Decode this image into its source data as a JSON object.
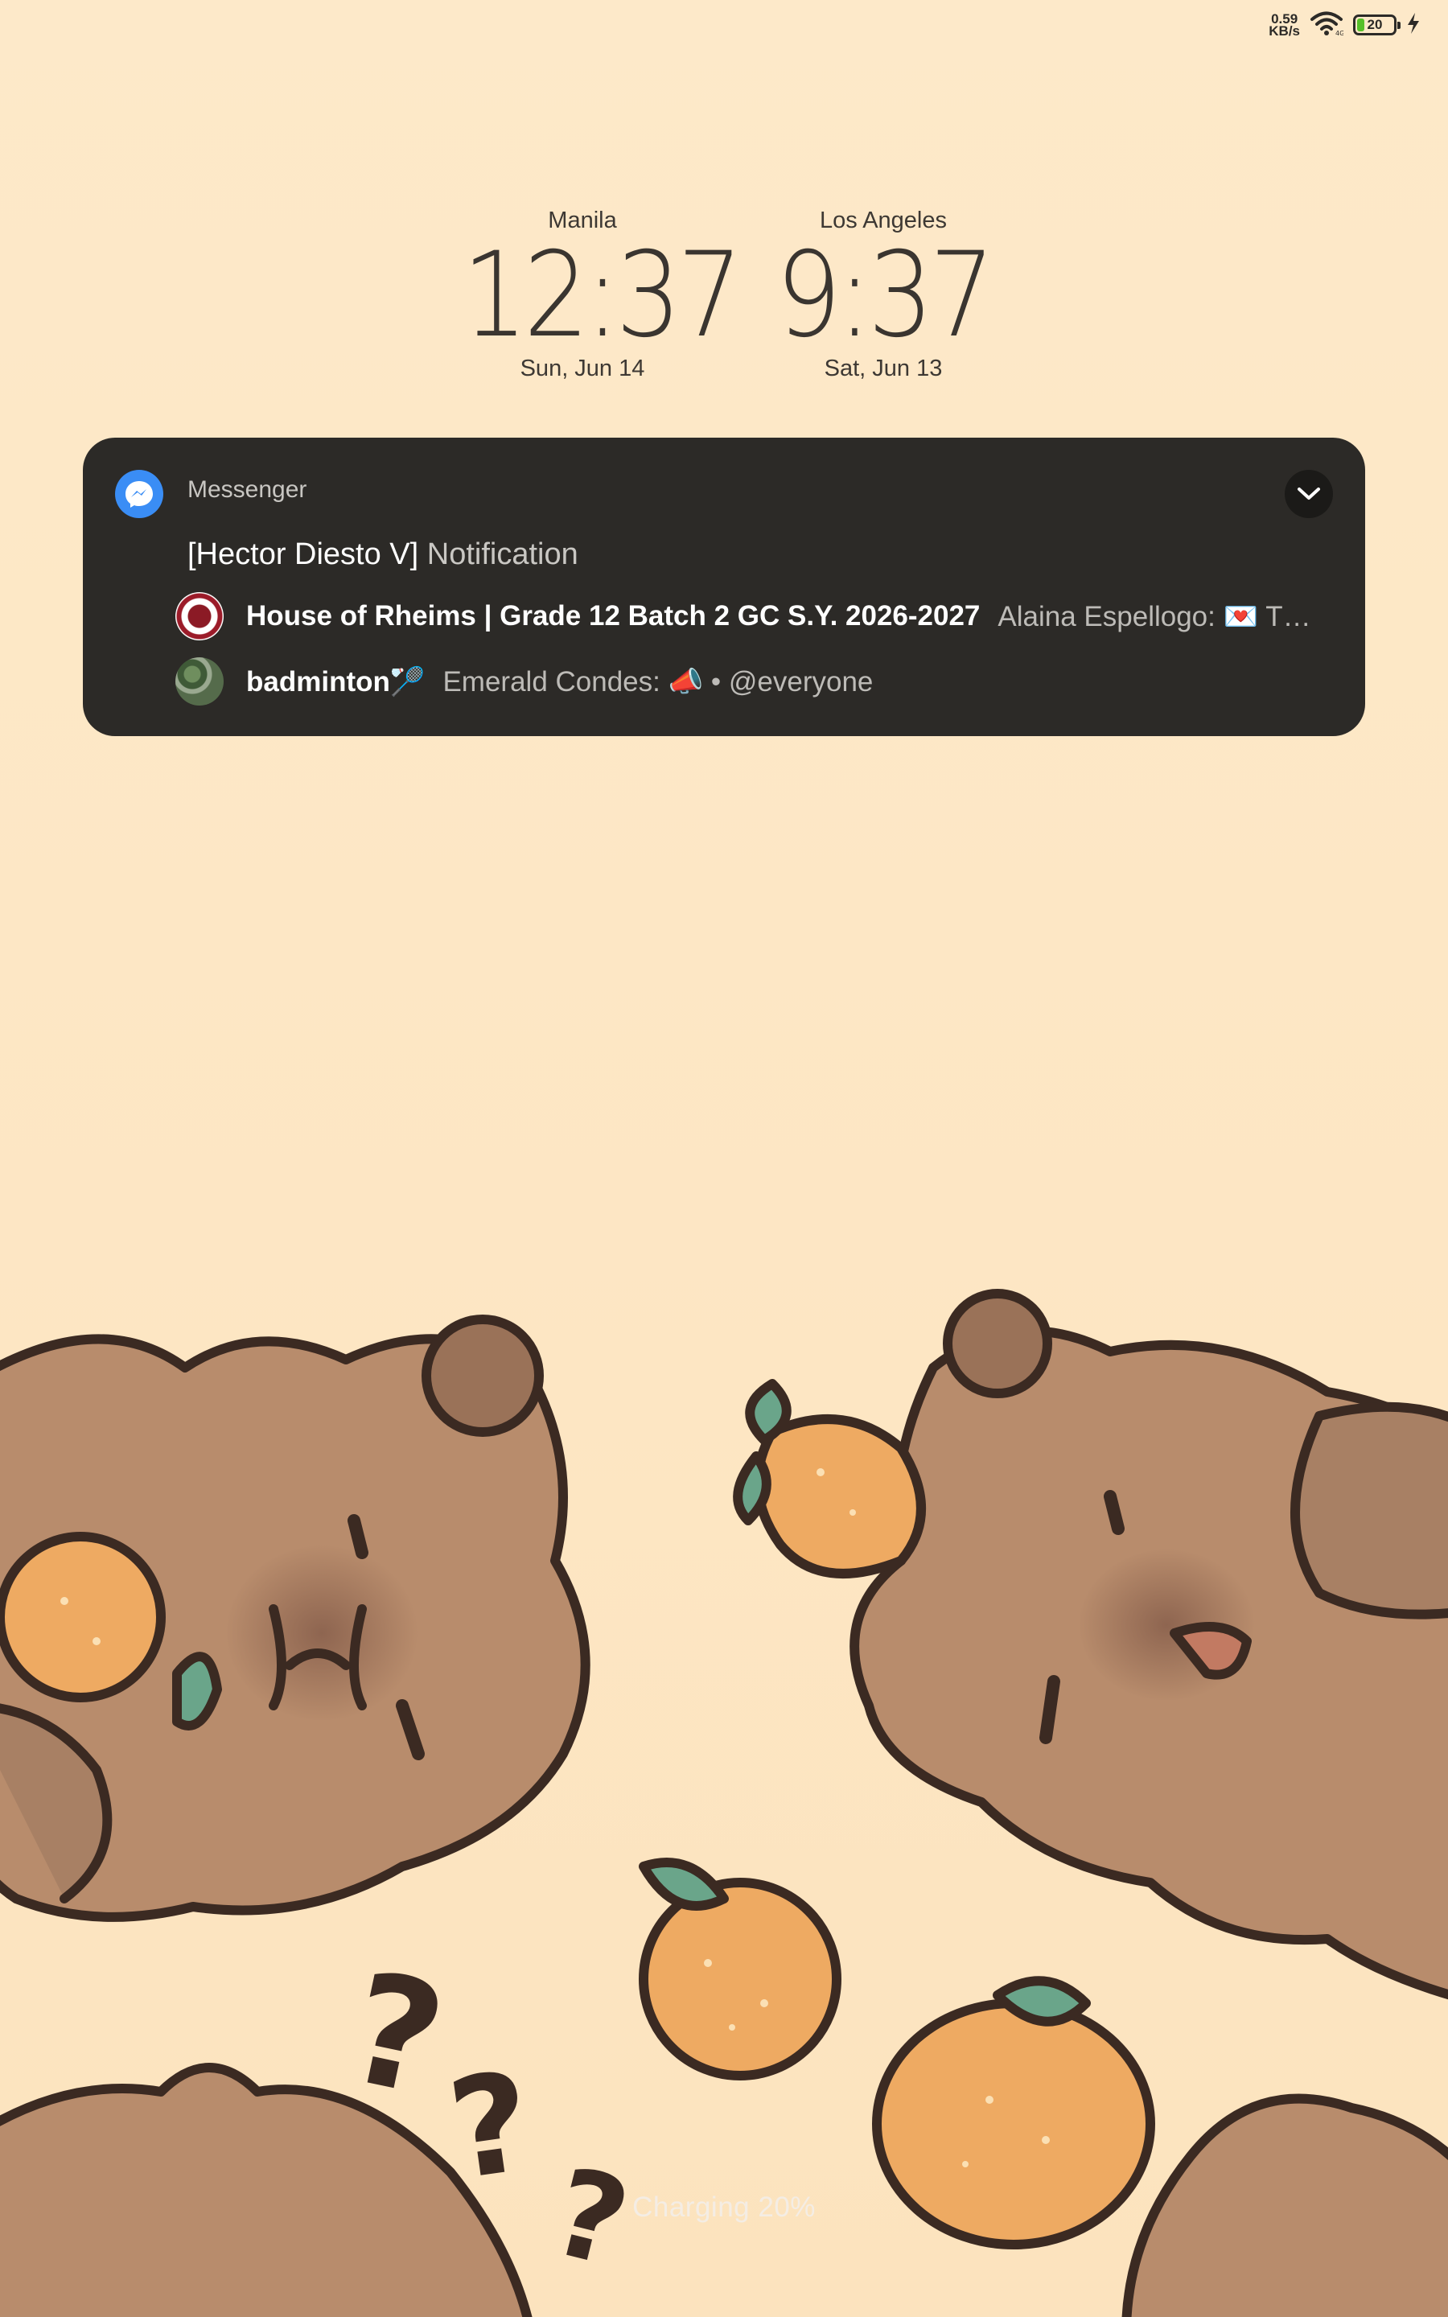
{
  "status_bar": {
    "net_speed_value": "0.59",
    "net_speed_unit": "KB/s",
    "battery_level": "20",
    "battery_fraction": 0.2,
    "icons": [
      "wifi-icon",
      "battery-icon",
      "charging-bolt-icon"
    ]
  },
  "clocks": [
    {
      "city": "Manila",
      "time": "12:37",
      "date": "Sun, Jun 14"
    },
    {
      "city": "Los Angeles",
      "time": "9:37",
      "date": "Sat, Jun 13"
    }
  ],
  "notification": {
    "app_name": "Messenger",
    "app_icon": "messenger-icon",
    "expand_icon": "chevron-down-icon",
    "title_sender": "[Hector Diesto V]",
    "title_rest": "Notification",
    "messages": [
      {
        "group": "House of Rheims | Grade 12 Batch 2 GC S.Y. 2026-2027",
        "preview": "Alaina Espellogo: 💌 The 𝐇𝐨𝐮𝐬𝐞 𝐨𝐟 𝐑𝐡𝐞𝐢𝐦𝐬"
      },
      {
        "group": "badminton🏸",
        "preview": "Emerald Condes: 📣 • @everyone"
      }
    ]
  },
  "wallpaper": {
    "description_icons": [
      "capybara-illustration",
      "orange-fruit-icon",
      "question-mark-icon"
    ],
    "colors": {
      "background": "#fde8c8",
      "capybara": "#b88c6c",
      "outline": "#3b2a22",
      "orange": "#eeaa62",
      "leaf": "#6aa58a"
    }
  },
  "charging": {
    "text": "Charging 20%"
  },
  "colors": {
    "notification_bg": "#2c2a27",
    "messenger_blue": "#3a8df5",
    "battery_green": "#56c02a"
  }
}
